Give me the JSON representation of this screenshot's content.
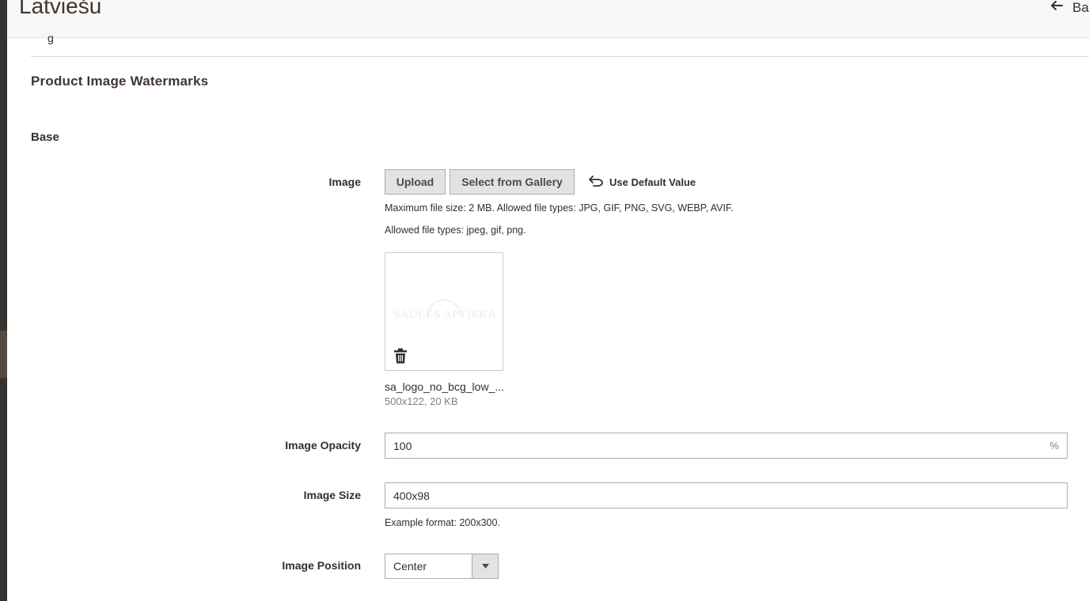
{
  "header": {
    "title": "Latviešu",
    "back_label": "Ba"
  },
  "previous_row_fragment": "g",
  "section": {
    "title": "Product Image Watermarks",
    "group_title": "Base"
  },
  "image_field": {
    "label": "Image",
    "upload_label": "Upload",
    "gallery_label": "Select from Gallery",
    "use_default_label": "Use Default Value",
    "note_max_size": "Maximum file size: 2 MB. Allowed file types: JPG, GIF, PNG, SVG, WEBP, AVIF.",
    "note_allowed": "Allowed file types: jpeg, gif, png.",
    "preview_logo_text": "SAULES APTIEKA",
    "file_name": "sa_logo_no_bcg_low_...",
    "file_meta": "500x122, 20 KB"
  },
  "opacity_field": {
    "label": "Image Opacity",
    "value": "100",
    "suffix": "%"
  },
  "size_field": {
    "label": "Image Size",
    "value": "400x98",
    "note": "Example format: 200x300."
  },
  "position_field": {
    "label": "Image Position",
    "value": "Center"
  },
  "icons": {
    "back": "arrow-left-icon",
    "use_default": "undo-icon",
    "delete": "trash-icon",
    "select": "caret-down-icon"
  }
}
